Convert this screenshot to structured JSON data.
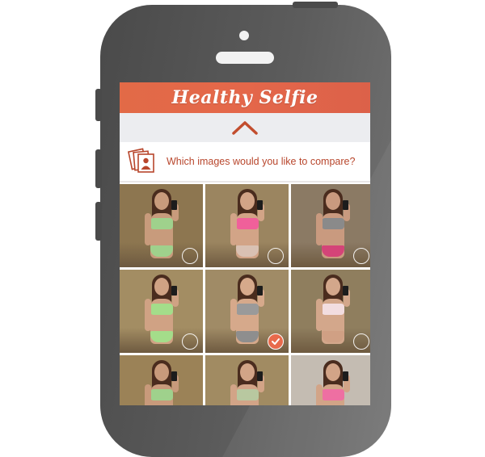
{
  "app": {
    "title": "Healthy Selfie"
  },
  "prompt": {
    "text": "Which images would you like to compare?",
    "icon": "photos-stack-icon"
  },
  "colors": {
    "accent": "#e36a49",
    "prompt_text": "#b8462c",
    "collapse_bg": "#ecedf0"
  },
  "photos": [
    {
      "bg": "#8d7650",
      "skin": "#c89b7c",
      "bra": "#9fd18c",
      "briefs": "#9fd18c",
      "selected": false
    },
    {
      "bg": "#9b8560",
      "skin": "#d2a487",
      "bra": "#f0609a",
      "briefs": "#d9c1b3",
      "selected": false
    },
    {
      "bg": "#8b7a64",
      "skin": "#c99a7f",
      "bra": "#8a8a8a",
      "briefs": "#d44478",
      "selected": false
    },
    {
      "bg": "#a38d63",
      "skin": "#d0a284",
      "bra": "#a4dd8a",
      "briefs": "#a4dd8a",
      "selected": false
    },
    {
      "bg": "#a08b66",
      "skin": "#d6a98b",
      "bra": "#9a9a9a",
      "briefs": "#8e8e8e",
      "selected": true
    },
    {
      "bg": "#8f7e5e",
      "skin": "#d3a78b",
      "bra": "#f2dde0",
      "briefs": "#d0a084",
      "selected": false
    },
    {
      "bg": "#9b8257",
      "skin": "#c89a7b",
      "bra": "#9fd18c",
      "briefs": "#9fd18c",
      "selected": false
    },
    {
      "bg": "#a18b62",
      "skin": "#d2a487",
      "bra": "#b8c8a0",
      "briefs": "#b8c8a0",
      "selected": false
    },
    {
      "bg": "#c4bcb2",
      "skin": "#d2a487",
      "bra": "#ee6fa2",
      "briefs": "#ee6fa2",
      "selected": false
    }
  ]
}
